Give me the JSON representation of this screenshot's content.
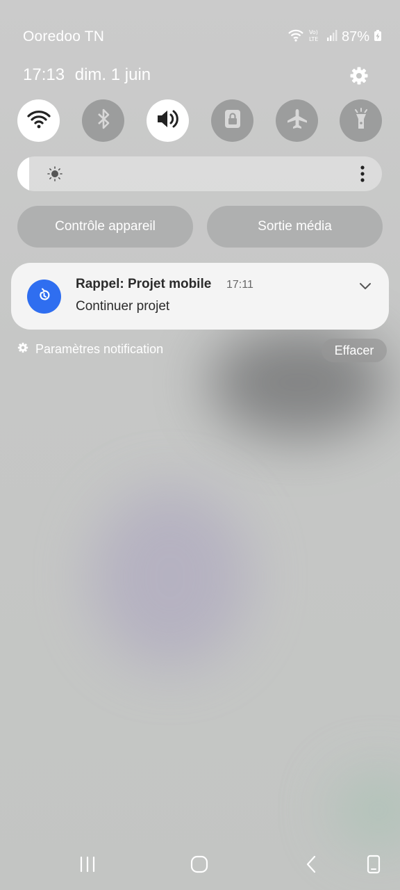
{
  "status_bar": {
    "carrier": "Ooredoo TN",
    "battery_percent": "87%",
    "icons": [
      "wifi-icon",
      "volte-lte-icon",
      "signal-icon",
      "battery-charging-icon"
    ]
  },
  "header": {
    "time": "17:13",
    "date": "dim. 1 juin"
  },
  "quick_toggles": [
    {
      "name": "wifi",
      "icon": "wifi-icon",
      "state": "on"
    },
    {
      "name": "bluetooth",
      "icon": "bluetooth-icon",
      "state": "off"
    },
    {
      "name": "sound",
      "icon": "volume-icon",
      "state": "on"
    },
    {
      "name": "rotation-lock",
      "icon": "lock-icon",
      "state": "off"
    },
    {
      "name": "airplane",
      "icon": "airplane-icon",
      "state": "off"
    },
    {
      "name": "flashlight",
      "icon": "flashlight-icon",
      "state": "off"
    }
  ],
  "brightness": {
    "level": 0.03
  },
  "panel_buttons": {
    "device_control": "Contrôle appareil",
    "media_output": "Sortie média"
  },
  "notification": {
    "title": "Rappel: Projet mobile",
    "time": "17:11",
    "body": "Continuer projet"
  },
  "notification_footer": {
    "settings_label": "Paramètres notification",
    "clear_label": "Effacer"
  },
  "colors": {
    "app_icon_bg": "#2f6ef0",
    "toggle_on": "#ffffff",
    "toggle_off": "#9c9d9d"
  }
}
